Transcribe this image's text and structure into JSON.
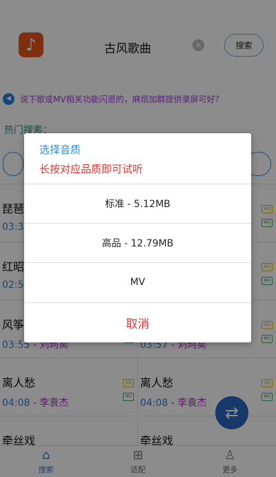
{
  "header": {
    "search_text": "古风歌曲",
    "clear_icon": "clear-icon",
    "search_button": "搜索"
  },
  "notice": {
    "text": "说下歌或MV相关功能闪退的，麻烦加群提供录屏可好？"
  },
  "hot": {
    "label": "热门搜索："
  },
  "songs": [
    [
      {
        "name": "琵琶",
        "time": "03:35",
        "artist": "",
        "badges": [
          "HQ",
          "MV"
        ]
      },
      {
        "name": "",
        "time": "",
        "artist": "",
        "badges": [
          "HQ",
          "MV"
        ]
      }
    ],
    [
      {
        "name": "红昭",
        "time": "02:53",
        "artist": "",
        "badges": [
          "HQ",
          "MV"
        ]
      },
      {
        "name": "",
        "time": "",
        "artist": "",
        "badges": [
          "HQ",
          "MV"
        ]
      }
    ],
    [
      {
        "name": "风筝",
        "time": "03:55",
        "artist": "- 刘珂矣",
        "badges": [
          "SQ",
          "MV"
        ]
      },
      {
        "name": "",
        "time": "03:57",
        "artist": "- 刘珂矣",
        "badges": [
          "SQ",
          "MV"
        ]
      }
    ],
    [
      {
        "name": "离人愁",
        "time": "04:08",
        "artist": "- 李袁杰",
        "badges": [
          "SQ",
          "MV"
        ]
      },
      {
        "name": "离人愁",
        "time": "04:08",
        "artist": "- 李袁杰",
        "badges": [
          "SQ",
          "MV"
        ]
      }
    ],
    [
      {
        "name": "牵丝戏",
        "time": "",
        "artist": "",
        "badges": []
      },
      {
        "name": "牵丝戏",
        "time": "",
        "artist": "",
        "badges": []
      }
    ]
  ],
  "tabs": [
    {
      "label": "搜索",
      "icon": "home-icon",
      "glyph": "⌂"
    },
    {
      "label": "适配",
      "icon": "grid-icon",
      "glyph": "⊞"
    },
    {
      "label": "更多",
      "icon": "person-icon",
      "glyph": "♙"
    }
  ],
  "dialog": {
    "title": "选择音质",
    "hint": "长按对应品质即可试听",
    "options": [
      {
        "label": "标准 - 5.12MB"
      },
      {
        "label": "高品 - 12.79MB"
      },
      {
        "label": "MV"
      }
    ],
    "cancel": "取消"
  },
  "colors": {
    "accent": "#2d8bd8",
    "danger": "#e03030",
    "artist": "#a82fc8",
    "app_icon": "#e9541e"
  }
}
